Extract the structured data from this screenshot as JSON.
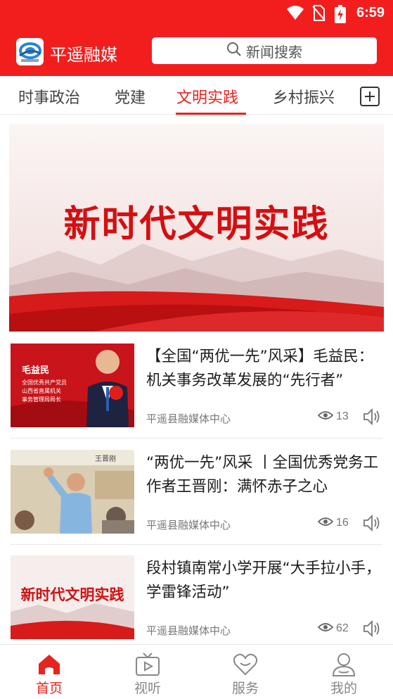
{
  "status_bar": {
    "time": "6:59",
    "icons": [
      "wifi-icon",
      "no-sim-icon",
      "battery-charging-icon"
    ]
  },
  "app": {
    "title": "平遥融媒",
    "logo_text": "平遥融媒"
  },
  "search": {
    "placeholder": "新闻搜索",
    "icon": "search-icon"
  },
  "tabs": [
    {
      "label": "时事政治",
      "active": false
    },
    {
      "label": "党建",
      "active": false
    },
    {
      "label": "文明实践",
      "active": true
    },
    {
      "label": "乡村振兴",
      "active": false
    }
  ],
  "tab_add_icon": "plus-square-icon",
  "banner": {
    "title": "新时代文明实践"
  },
  "news": [
    {
      "title": "【全国“两优一先”风采】毛益民：机关事务改革发展的“先行者”",
      "source": "平遥县融媒体中心",
      "views": "13",
      "thumb": {
        "name": "毛益民",
        "lines": [
          "全国优秀共产党员",
          "山西省直属机关",
          "事务管理局局长"
        ]
      }
    },
    {
      "title": "“两优一先”风采 丨全国优秀党务工作者王晋刚：满怀赤子之心",
      "source": "平遥县融媒体中心",
      "views": "16",
      "thumb": {
        "caption": "王晋刚"
      }
    },
    {
      "title": "段村镇南常小学开展“大手拉小手，学雷锋活动”",
      "source": "平遥县融媒体中心",
      "views": "62",
      "thumb": {
        "caption": "新时代文明实践"
      }
    }
  ],
  "bottom_nav": [
    {
      "label": "首页",
      "icon": "home-icon",
      "active": true
    },
    {
      "label": "视听",
      "icon": "tv-icon",
      "active": false
    },
    {
      "label": "服务",
      "icon": "heart-icon",
      "active": false
    },
    {
      "label": "我的",
      "icon": "user-icon",
      "active": false
    }
  ],
  "colors": {
    "brand": "#f21e1e",
    "accent": "#e8231f"
  }
}
